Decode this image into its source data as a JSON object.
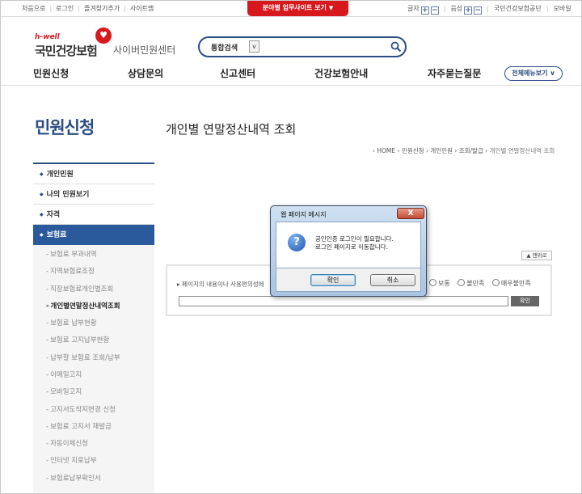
{
  "topbar": {
    "links": [
      "처음으로",
      "로그인",
      "즐겨찾기추가",
      "사이트맵"
    ],
    "center_label": "분야별 업무사이트 보기",
    "font_label": "글자",
    "volume_label": "음성",
    "plus": "+",
    "minus": "−",
    "org_link": "국민건강보험공단",
    "mobile_link": "모바일"
  },
  "header": {
    "logo_top": "h-well",
    "logo_name": "국민건강보험",
    "logo_sub": "사이버민원센터"
  },
  "search": {
    "label": "통합검색",
    "dropdown": "v",
    "placeholder": ""
  },
  "nav": {
    "items": [
      "민원신청",
      "상담문의",
      "신고센터",
      "건강보험안내",
      "자주묻는질문"
    ],
    "all_menu": "전체메뉴보기"
  },
  "sidebar": {
    "title": "민원신청",
    "bullet": "◆",
    "items": [
      "개인민원",
      "나의 민원보기",
      "자격",
      "보험료"
    ],
    "sub_items": [
      "보험료 부과내역",
      "지역보험료조정",
      "직장보험료개인별조회",
      "개인별연말정산내역조회",
      "보험료 납부현황",
      "보험료 고지납부현황",
      "납부할 보험료 조회/납부",
      "이메일고지",
      "모바일고지",
      "고지서도착지변경 신청",
      "보험료 고지서 재발급",
      "자동이체신청",
      "인터넷 지로납부",
      "보험료납부확인서"
    ]
  },
  "content": {
    "title": "개인별 연말정산내역 조회",
    "breadcrumb_home": "HOME",
    "breadcrumb_1": "민원신청",
    "breadcrumb_2": "개인민원",
    "breadcrumb_3": "조회/발급",
    "breadcrumb_current": "개인별 연말정산내역 조회",
    "menu_btn": "맨위로"
  },
  "survey": {
    "question": "페이지의 내용이나 사용편의성에",
    "options": [
      "보통",
      "불만족",
      "매우불만족"
    ],
    "ok": "확인"
  },
  "dialog": {
    "title": "웹 페이지 메시지",
    "close": "X",
    "line1": "공인인증 로그인이 필요합니다.",
    "line2": "로그인 페이지로 이동합니다.",
    "ok": "확인",
    "cancel": "취소",
    "icon": "?"
  }
}
